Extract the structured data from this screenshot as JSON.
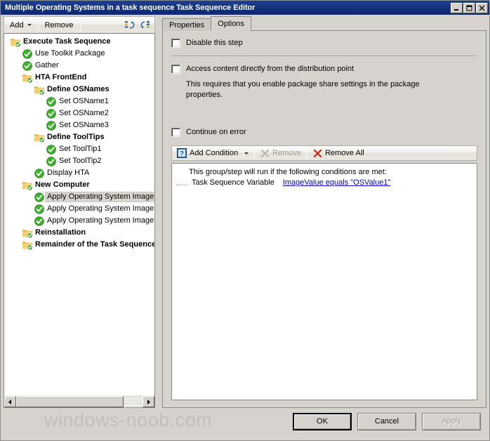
{
  "window": {
    "title": "Multiple Operating Systems in a task sequence Task Sequence Editor",
    "minimize_label": "Minimize",
    "maximize_label": "Maximize",
    "close_label": "Close"
  },
  "toolbar": {
    "add_label": "Add",
    "remove_label": "Remove",
    "move_up_label": "Move Up",
    "move_down_label": "Move Down"
  },
  "tree": {
    "items": [
      {
        "label": "Execute Task Sequence",
        "indent": 0,
        "type": "group",
        "selected": false
      },
      {
        "label": "Use Toolkit Package",
        "indent": 1,
        "type": "step",
        "selected": false
      },
      {
        "label": "Gather",
        "indent": 1,
        "type": "step",
        "selected": false
      },
      {
        "label": "HTA FrontEnd",
        "indent": 1,
        "type": "group",
        "selected": false
      },
      {
        "label": "Define OSNames",
        "indent": 2,
        "type": "group",
        "selected": false
      },
      {
        "label": "Set OSName1",
        "indent": 3,
        "type": "step",
        "selected": false
      },
      {
        "label": "Set OSName2",
        "indent": 3,
        "type": "step",
        "selected": false
      },
      {
        "label": "Set OSName3",
        "indent": 3,
        "type": "step",
        "selected": false
      },
      {
        "label": "Define ToolTips",
        "indent": 2,
        "type": "group",
        "selected": false
      },
      {
        "label": "Set ToolTip1",
        "indent": 3,
        "type": "step",
        "selected": false
      },
      {
        "label": "Set ToolTip2",
        "indent": 3,
        "type": "step",
        "selected": false
      },
      {
        "label": "Display HTA",
        "indent": 2,
        "type": "step",
        "selected": false
      },
      {
        "label": "New Computer",
        "indent": 1,
        "type": "group",
        "selected": false
      },
      {
        "label": "Apply Operating System Image",
        "indent": 2,
        "type": "step",
        "selected": true
      },
      {
        "label": "Apply Operating System Image",
        "indent": 2,
        "type": "step",
        "selected": false
      },
      {
        "label": "Apply Operating System Image",
        "indent": 2,
        "type": "step",
        "selected": false
      },
      {
        "label": "Reinstallation",
        "indent": 1,
        "type": "group",
        "selected": false
      },
      {
        "label": "Remainder of the Task Sequence",
        "indent": 1,
        "type": "group",
        "selected": false
      }
    ]
  },
  "tabs": [
    {
      "label": "Properties",
      "active": false
    },
    {
      "label": "Options",
      "active": true
    }
  ],
  "options": {
    "disable_step_label": "Disable this step",
    "disable_step_checked": false,
    "access_content_label": "Access content directly from the distribution point",
    "access_content_checked": false,
    "access_content_note": "This requires that you enable package share settings in the package properties.",
    "continue_on_error_label": "Continue on error",
    "continue_on_error_checked": false
  },
  "conditions_toolbar": {
    "add_condition_label": "Add Condition",
    "remove_label": "Remove",
    "remove_all_label": "Remove All"
  },
  "conditions": {
    "header": "This group/step will run if the following conditions are met:",
    "rows": [
      {
        "type": "Task Sequence Variable",
        "expression": "ImageValue equals \"OSValue1\""
      }
    ]
  },
  "footer": {
    "watermark": "windows-noob.com",
    "ok_label": "OK",
    "cancel_label": "Cancel",
    "apply_label": "Apply"
  },
  "colors": {
    "titlebar": "#113078",
    "dialog_face": "#d6d3ce",
    "link": "#0000cc",
    "folder": "#f3c75b",
    "check_green": "#2aa632",
    "selection": "#d8d5cd"
  }
}
